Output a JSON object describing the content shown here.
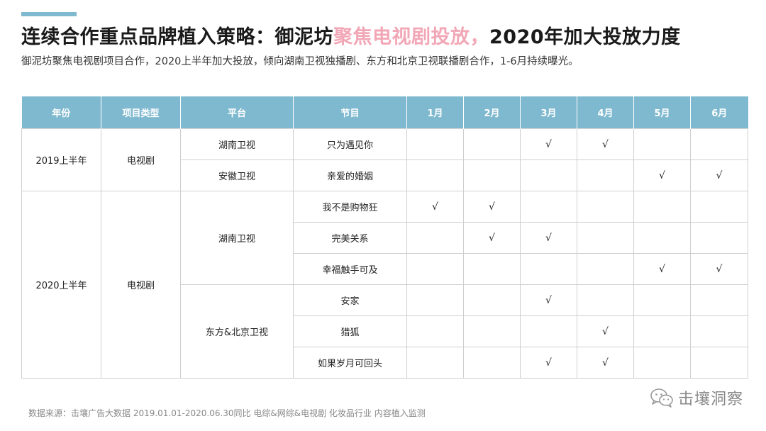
{
  "title": {
    "part1": "连续合作重点品牌植入策略：御泥坊",
    "highlight": "聚焦电视剧投放，",
    "part2": "2020年加大投放力度"
  },
  "subtitle": "御泥坊聚焦电视剧项目合作，2020上半年加大投放，倾向湖南卫视独播剧、东方和北京卫视联播剧合作，1-6月持续曝光。",
  "colors": {
    "header_bg": "#7fb9cf",
    "highlight": "#f2a7b6"
  },
  "table": {
    "headers": [
      "年份",
      "项目类型",
      "平台",
      "节目",
      "1月",
      "2月",
      "3月",
      "4月",
      "5月",
      "6月"
    ],
    "check_mark": "√",
    "groups": [
      {
        "year": "2019上半年",
        "type": "电视剧"
      },
      {
        "year": "2020上半年",
        "type": "电视剧"
      }
    ],
    "platforms": [
      "湖南卫视",
      "安徽卫视",
      "湖南卫视",
      "东方&北京卫视"
    ],
    "rows": [
      {
        "program": "只为遇见你",
        "months": [
          false,
          false,
          true,
          true,
          false,
          false
        ]
      },
      {
        "program": "亲爱的婚姻",
        "months": [
          false,
          false,
          false,
          false,
          true,
          true
        ]
      },
      {
        "program": "我不是购物狂",
        "months": [
          true,
          true,
          false,
          false,
          false,
          false
        ]
      },
      {
        "program": "完美关系",
        "months": [
          false,
          true,
          true,
          false,
          false,
          false
        ]
      },
      {
        "program": "幸福触手可及",
        "months": [
          false,
          false,
          false,
          false,
          true,
          true
        ]
      },
      {
        "program": "安家",
        "months": [
          false,
          false,
          true,
          false,
          false,
          false
        ]
      },
      {
        "program": "猎狐",
        "months": [
          false,
          false,
          false,
          true,
          false,
          false
        ]
      },
      {
        "program": "如果岁月可回头",
        "months": [
          false,
          false,
          true,
          true,
          false,
          false
        ]
      }
    ]
  },
  "source": "数据来源：击壤广告大数据 2019.01.01-2020.06.30同比 电综&网综&电视剧 化妆品行业 内容植入监测",
  "brand": {
    "icon": "wechat-icon",
    "name": "击壤洞察"
  }
}
